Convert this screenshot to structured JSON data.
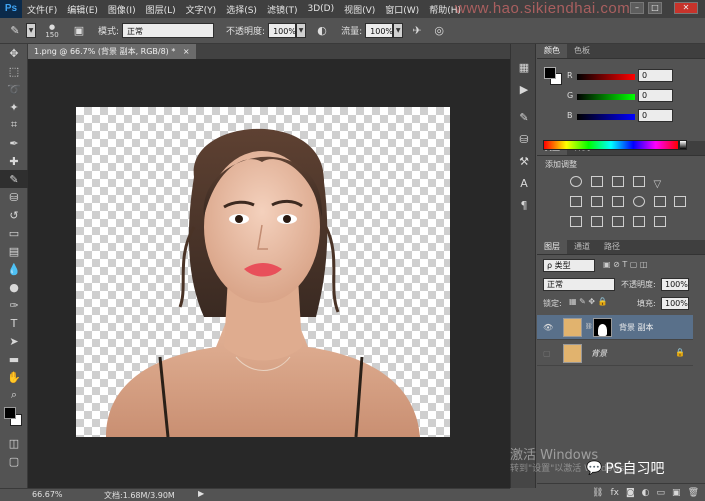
{
  "app": {
    "logo": "Ps"
  },
  "menu": {
    "items": [
      "文件(F)",
      "编辑(E)",
      "图像(I)",
      "图层(L)",
      "文字(Y)",
      "选择(S)",
      "滤镜(T)",
      "3D(D)",
      "视图(V)",
      "窗口(W)",
      "帮助(H)"
    ],
    "watermark": "www.hao.sikiendhai.com"
  },
  "options": {
    "brush_size": "150",
    "mode_label": "模式:",
    "mode_value": "正常",
    "opacity_label": "不透明度:",
    "opacity_value": "100%",
    "flow_label": "流量:",
    "flow_value": "100%"
  },
  "document": {
    "tab_title": "1.png @ 66.7% (背景 副本, RGB/8) *",
    "close": "×"
  },
  "status": {
    "zoom": "66.67%",
    "doc_info": "文档:1.68M/3.90M",
    "arrow": "▶"
  },
  "color_panel": {
    "tabs": [
      "颜色",
      "色板"
    ],
    "r_label": "R",
    "g_label": "G",
    "b_label": "B",
    "r_value": "0",
    "g_value": "0",
    "b_value": "0",
    "foreground": "#000000",
    "background": "#ffffff"
  },
  "adjustments_panel": {
    "tabs": [
      "调整",
      "样式"
    ],
    "add_label": "添加调整"
  },
  "layers_panel": {
    "tabs": [
      "图层",
      "通道",
      "路径"
    ],
    "filter_kind": "ρ 类型",
    "blend_mode": "正常",
    "opacity_label": "不透明度:",
    "opacity_value": "100%",
    "lock_label": "锁定:",
    "fill_label": "填充:",
    "fill_value": "100%",
    "layers": [
      {
        "name": "背景 副本",
        "visible": true,
        "active": true
      },
      {
        "name": "背景",
        "visible": false,
        "active": false
      }
    ]
  },
  "overlay": {
    "activation_title": "激活 Windows",
    "activation_sub": "转到\"设置\"以激活 Windows。",
    "wechat_label": "PS自习吧"
  }
}
